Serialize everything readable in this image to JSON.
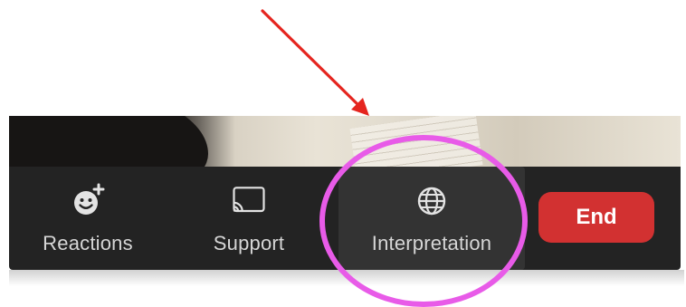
{
  "toolbar": {
    "reactions": {
      "label": "Reactions",
      "icon": "smiley-plus-icon"
    },
    "support": {
      "label": "Support",
      "icon": "cast-screen-icon"
    },
    "interpretation": {
      "label": "Interpretation",
      "icon": "globe-icon"
    },
    "end": {
      "label": "End",
      "color": "#d23131"
    }
  },
  "annotations": {
    "arrow_color": "#e5251f",
    "highlight_color": "#e85be8"
  },
  "colors": {
    "toolbar_bg": "#232323",
    "active_button_bg": "#333333",
    "label_text": "#d6d6d6"
  }
}
